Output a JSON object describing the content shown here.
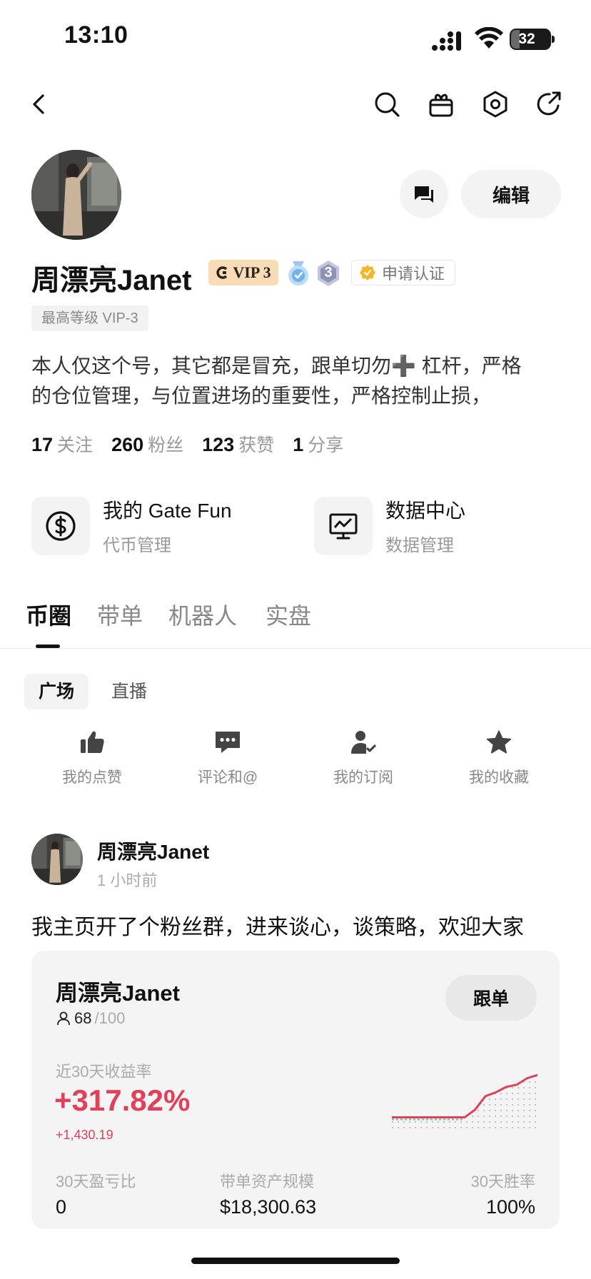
{
  "status_bar": {
    "time": "13:10",
    "battery": "32"
  },
  "profile": {
    "name": "周漂亮Janet",
    "vip_badge": "VIP 3",
    "level_badge": "3",
    "apply_cert": "申请认证",
    "top_level_tag": "最高等级 VIP-3",
    "bio_line1": "本人仅这个号，其它都是冒充，跟单切勿➕ 杠杆，严格",
    "bio_line2": "的仓位管理，与位置进场的重要性，严格控制止损，",
    "edit_label": "编辑",
    "stats": [
      {
        "value": "17",
        "label": "关注"
      },
      {
        "value": "260",
        "label": "粉丝"
      },
      {
        "value": "123",
        "label": "获赞"
      },
      {
        "value": "1",
        "label": "分享"
      }
    ]
  },
  "features": [
    {
      "title": "我的 Gate Fun",
      "subtitle": "代币管理",
      "icon": "dollar-coin-icon"
    },
    {
      "title": "数据中心",
      "subtitle": "数据管理",
      "icon": "chart-monitor-icon"
    }
  ],
  "tabs": [
    "币圈",
    "带单",
    "机器人",
    "实盘"
  ],
  "subtabs": [
    "广场",
    "直播"
  ],
  "shortcuts": [
    {
      "label": "我的点赞",
      "icon": "thumbs-up-icon"
    },
    {
      "label": "评论和@",
      "icon": "comment-icon"
    },
    {
      "label": "我的订阅",
      "icon": "subscribe-user-icon"
    },
    {
      "label": "我的收藏",
      "icon": "star-icon"
    }
  ],
  "post": {
    "author": "周漂亮Janet",
    "time": "1 小时前",
    "text": "我主页开了个粉丝群，进来谈心，谈策略，欢迎大家",
    "card": {
      "name": "周漂亮Janet",
      "followers_current": "68",
      "followers_max": "/100",
      "follow_label": "跟单",
      "return_label": "近30天收益率",
      "return_pct": "+317.82%",
      "return_abs": "+1,430.19",
      "metrics": [
        {
          "label": "30天盈亏比",
          "value": "0"
        },
        {
          "label": "带单资产规模",
          "value": "$18,300.63"
        },
        {
          "label": "30天胜率",
          "value": "100%"
        }
      ],
      "sparkline": [
        0.06,
        0.06,
        0.06,
        0.06,
        0.06,
        0.06,
        0.06,
        0.06,
        0.2,
        0.45,
        0.52,
        0.62,
        0.66,
        0.78,
        0.84
      ],
      "accent_color": "#e0405a"
    }
  }
}
